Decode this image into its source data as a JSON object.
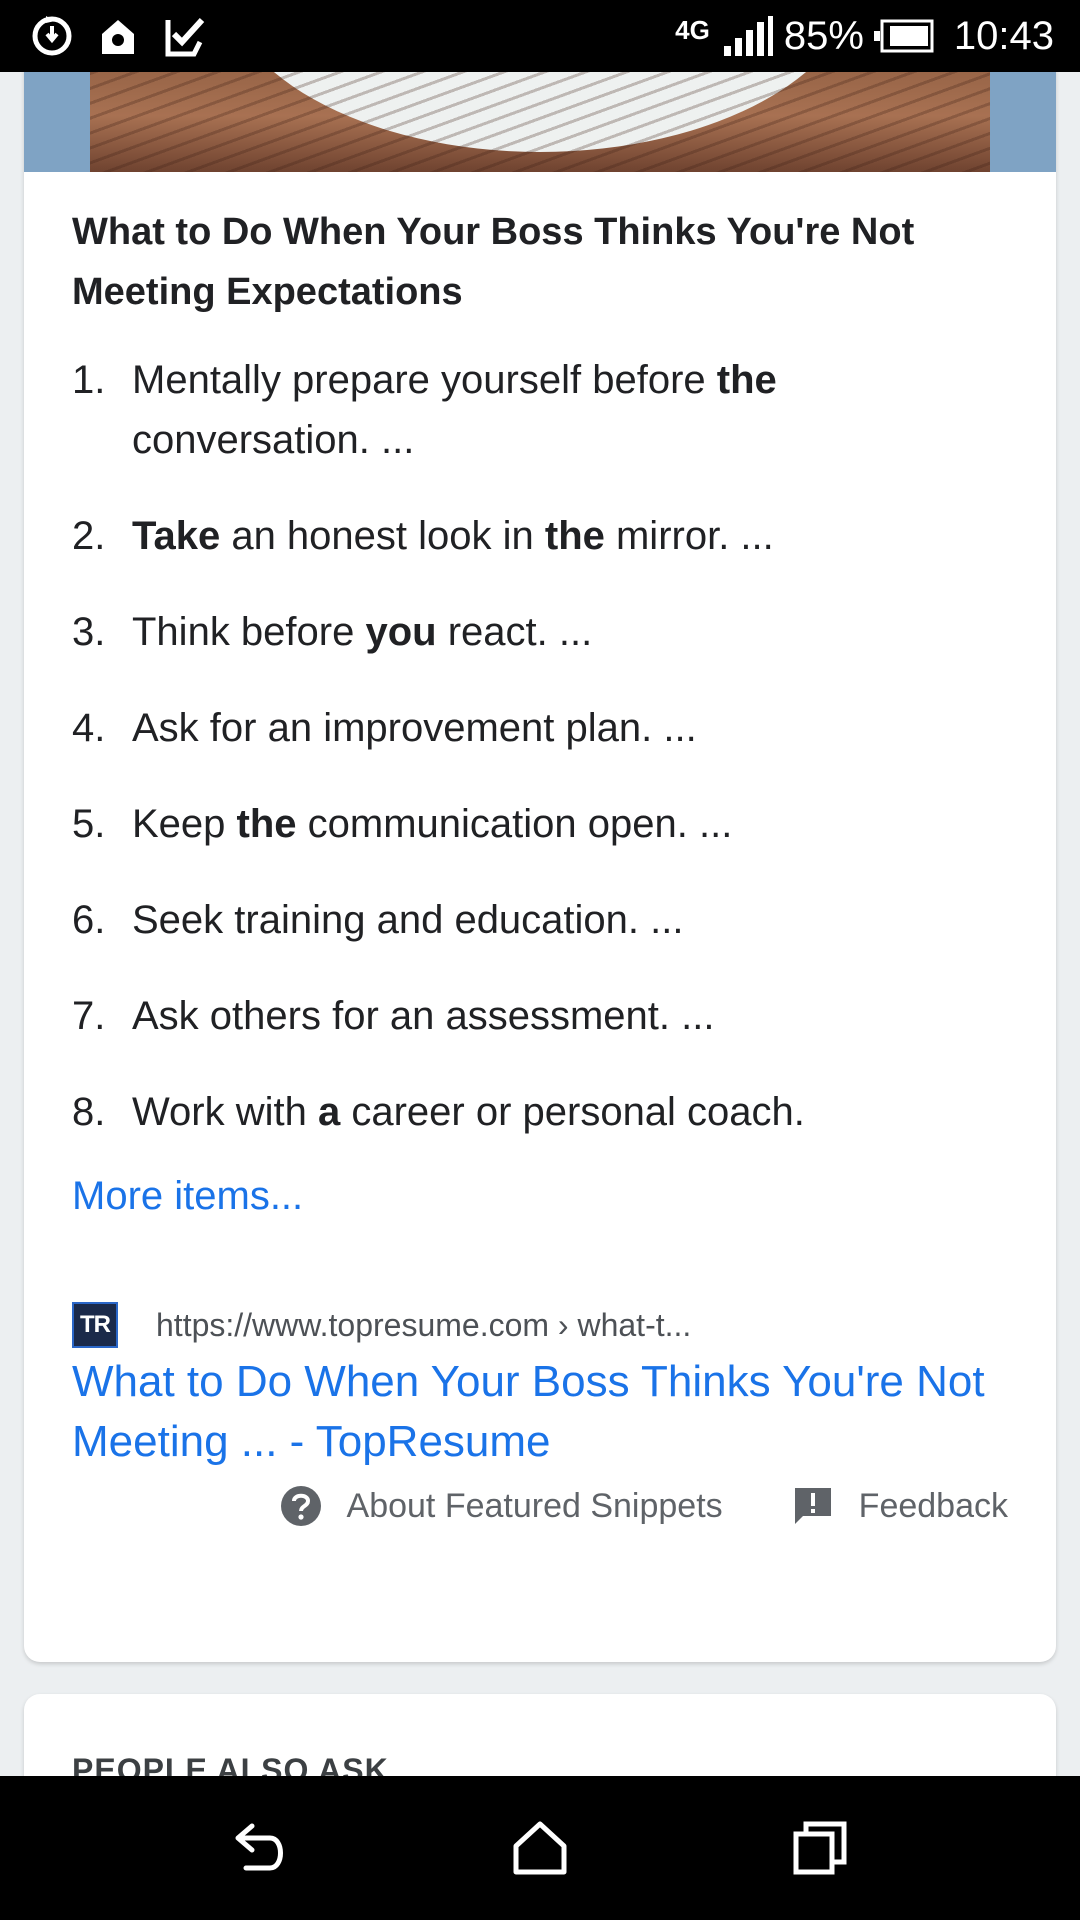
{
  "status_bar": {
    "network": "4G",
    "battery": "85%",
    "time": "10:43",
    "icons": [
      "sync-icon",
      "location-icon",
      "task-check-icon",
      "signal-icon",
      "battery-icon"
    ]
  },
  "snippet": {
    "title": "What to Do When Your Boss Thinks You're Not Meeting Expectations",
    "steps": [
      {
        "num": "1.",
        "parts": [
          {
            "t": "Mentally prepare yourself before "
          },
          {
            "t": "the",
            "b": true
          },
          {
            "t": " conversation. ..."
          }
        ]
      },
      {
        "num": "2.",
        "parts": [
          {
            "t": "Take",
            "b": true
          },
          {
            "t": " an honest look in "
          },
          {
            "t": "the",
            "b": true
          },
          {
            "t": " mirror. ..."
          }
        ]
      },
      {
        "num": "3.",
        "parts": [
          {
            "t": "Think before "
          },
          {
            "t": "you",
            "b": true
          },
          {
            "t": " react. ..."
          }
        ]
      },
      {
        "num": "4.",
        "parts": [
          {
            "t": "Ask for an improvement plan. ..."
          }
        ]
      },
      {
        "num": "5.",
        "parts": [
          {
            "t": "Keep "
          },
          {
            "t": "the",
            "b": true
          },
          {
            "t": " communication open. ..."
          }
        ]
      },
      {
        "num": "6.",
        "parts": [
          {
            "t": "Seek training and education. ..."
          }
        ]
      },
      {
        "num": "7.",
        "parts": [
          {
            "t": "Ask others for an assessment. ..."
          }
        ]
      },
      {
        "num": "8.",
        "parts": [
          {
            "t": "Work with "
          },
          {
            "t": "a",
            "b": true
          },
          {
            "t": " career or personal coach."
          }
        ]
      }
    ],
    "more_items": "More items...",
    "favicon_text": "TR",
    "source_url": "https://www.topresume.com › what-t...",
    "result_title": "What to Do When Your Boss Thinks You're Not Meeting ... - TopResume",
    "about_label": "About Featured Snippets",
    "feedback_label": "Feedback"
  },
  "people_also_ask": {
    "title": "PEOPLE ALSO ASK"
  },
  "colors": {
    "link": "#1a73e8",
    "text": "#202124",
    "muted": "#5f6368",
    "bar": "#000000"
  }
}
